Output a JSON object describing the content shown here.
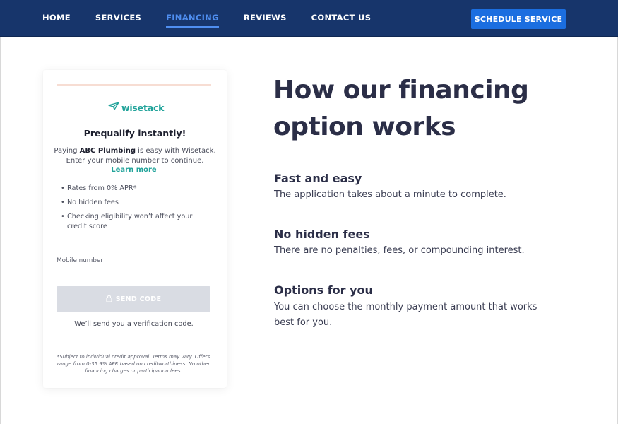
{
  "nav": {
    "links": [
      "HOME",
      "SERVICES",
      "FINANCING",
      "REVIEWS",
      "CONTACT US"
    ],
    "active": "FINANCING",
    "cta_label": "SCHEDULE SERVICE"
  },
  "colors": {
    "nav_bg": "#17356b",
    "active_link": "#4f8ef0",
    "cta_bg": "#1b6ee0",
    "brand_teal": "#21a39a",
    "heading": "#2b2e47",
    "disabled_button": "#d9dce3"
  },
  "card": {
    "logo_text": "wisetack",
    "logo_icon": "paper-plane-icon",
    "title": "Prequalify instantly!",
    "desc_prefix": "Paying ",
    "desc_company": "ABC Plumbing",
    "desc_suffix": " is easy with Wisetack. Enter your mobile number to continue.",
    "learn_more": "Learn more",
    "bullets": [
      "Rates from 0% APR*",
      "No hidden fees",
      "Checking eligibility won’t affect your credit score"
    ],
    "mobile_placeholder": "Mobile number",
    "send_label": "SEND CODE",
    "send_icon": "lock-icon",
    "send_disabled": true,
    "verification_note": "We’ll send you a verification code.",
    "disclaimer": "*Subject to individual credit approval. Terms may vary. Offers range from 0-35.9% APR based on creditworthiness. No other financing charges or participation fees."
  },
  "content": {
    "title": "How our financing option works",
    "features": [
      {
        "title": "Fast and easy",
        "text": "The application takes about a minute to complete."
      },
      {
        "title": "No hidden fees",
        "text": "There are no penalties, fees, or compounding interest."
      },
      {
        "title": "Options for you",
        "text": "You can choose the monthly payment amount that works best for you."
      }
    ]
  }
}
